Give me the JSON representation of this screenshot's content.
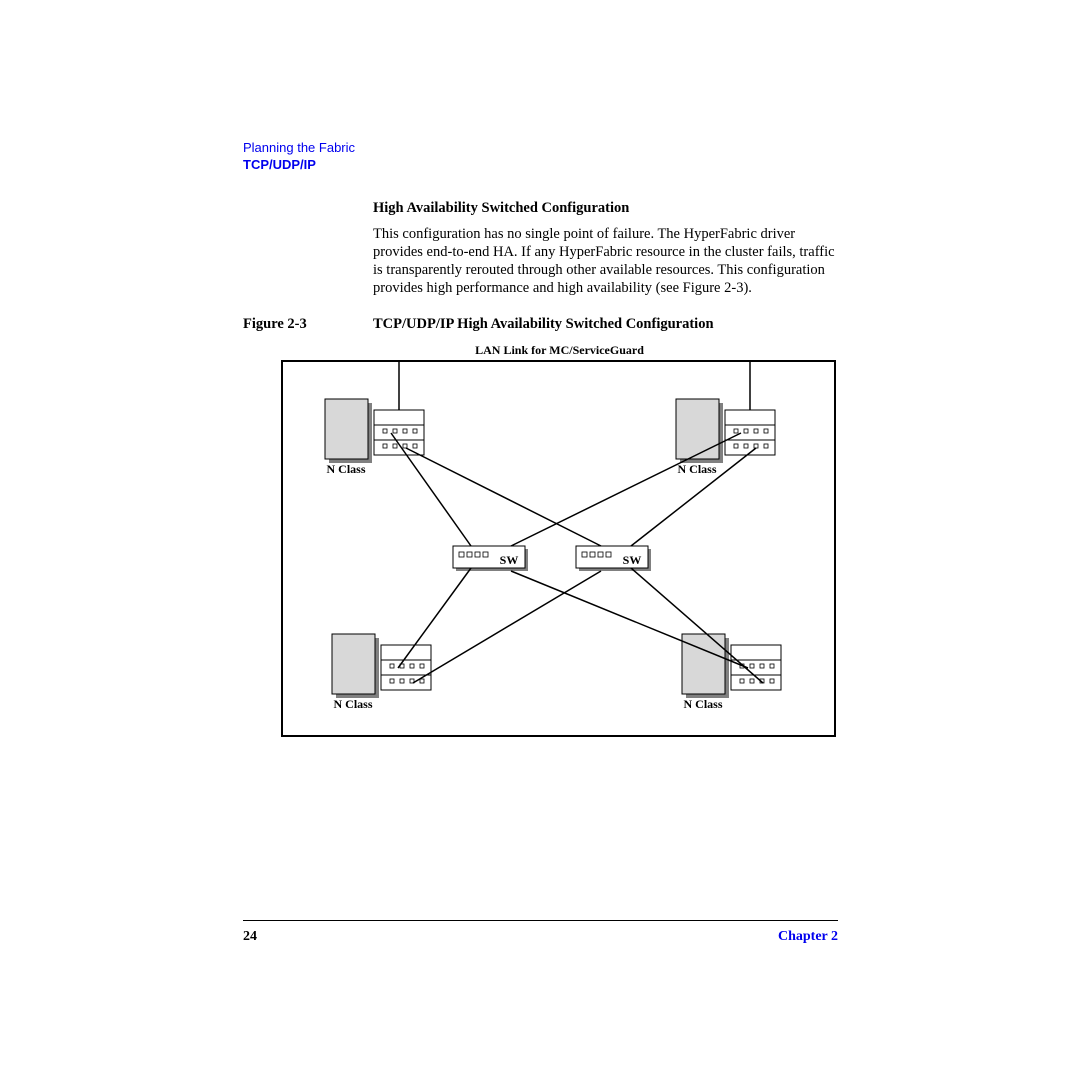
{
  "header": {
    "line1": "Planning the Fabric",
    "line2": "TCP/UDP/IP"
  },
  "section": {
    "title": "High Availability Switched Configuration",
    "paragraph": "This configuration has no single point of failure. The HyperFabric driver provides end-to-end HA. If any HyperFabric resource in the cluster fails, traffic is transparently rerouted through other available resources. This configuration provides high performance and high availability (see Figure 2-3)."
  },
  "figure": {
    "label": "Figure 2-3",
    "title": "TCP/UDP/IP High Availability Switched Configuration",
    "toplabel": "LAN Link for MC/ServiceGuard",
    "node_tl": "N Class",
    "node_tr": "N Class",
    "node_bl": "N Class",
    "node_br": "N Class",
    "switch_l": "SW",
    "switch_r": "SW"
  },
  "footer": {
    "page": "24",
    "chapter": "Chapter 2"
  }
}
